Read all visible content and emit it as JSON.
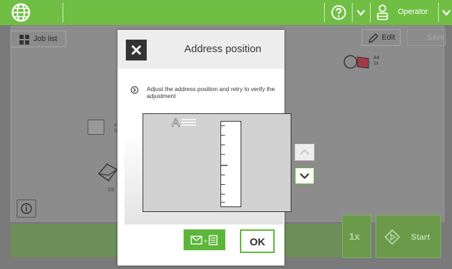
{
  "topbar": {
    "user_label": "Operator",
    "accent": "#70bf44"
  },
  "background": {
    "job_list_label": "Job list",
    "edit_label": "Edit",
    "save_label": "Save",
    "paper_size": "A4",
    "paper_count": "1x",
    "envelope_label": "C5",
    "small_text_1": "ex",
    "small_text_2": "S",
    "count_label": "1x",
    "start_label": "Start"
  },
  "dialog": {
    "title": "Address position",
    "instruction": "Adjust the address position and retry to verify the adjustment",
    "address_glyph": "A",
    "ok_label": "OK",
    "ok_border": "#5db63a"
  }
}
